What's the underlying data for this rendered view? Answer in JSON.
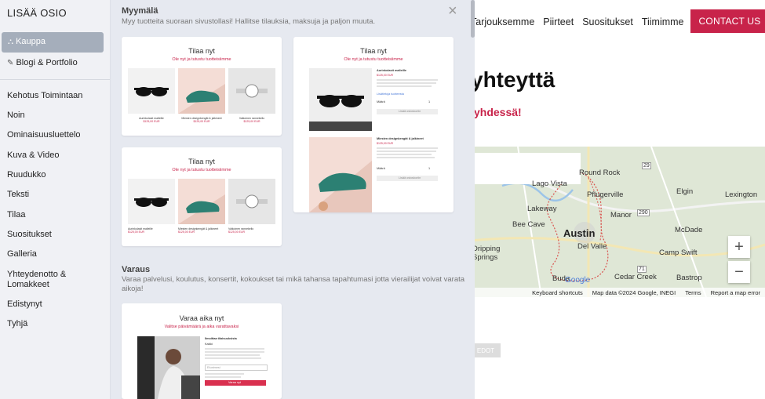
{
  "site": {
    "nav": [
      "Tarjouksemme",
      "Piirteet",
      "Suositukset",
      "Tiimimme"
    ],
    "contact_label": "CONTACT US",
    "heading": "yhteyttä",
    "subheading": "yhdessä!",
    "ghost_button": "EDOT",
    "map": {
      "labels": [
        "Round Rock",
        "Pflugerville",
        "Lago Vista",
        "Lakeway",
        "Manor",
        "Elgin",
        "Bee Cave",
        "McDade",
        "Austin",
        "Dripping Springs",
        "Del Valle",
        "Camp Swift",
        "Buda",
        "Cedar Creek",
        "Bastrop",
        "Lexington"
      ],
      "roads": [
        "29",
        "290",
        "71"
      ],
      "zoom_in": "+",
      "zoom_out": "−",
      "footer": [
        "Keyboard shortcuts",
        "Map data ©2024 Google, INEGI",
        "Terms",
        "Report a map error"
      ],
      "google": "Google"
    }
  },
  "sidebar": {
    "title": "LISÄÄ OSIO",
    "active": "Kauppa",
    "blog": "Blogi & Portfolio",
    "items": [
      "Kehotus Toimintaan",
      "Noin",
      "Ominaisuusluettelo",
      "Kuva & Video",
      "Ruudukko",
      "Teksti",
      "Tilaa",
      "Suositukset",
      "Galleria",
      "Yhteydenotto &",
      "Lomakkeet",
      "Edistynyt",
      "Tyhjä"
    ]
  },
  "panel": {
    "close": "×",
    "shop": {
      "title": "Myymälä",
      "desc": "Myy tuotteita suoraan sivustollasi! Hallitse tilauksia, maksuja ja paljon muuta."
    },
    "booking": {
      "title": "Varaus",
      "desc1": "Varaa palvelusi, koulutus, konsertit, kokoukset tai mikä tahansa tapahtumasi jotta vierailijat voivat varata",
      "desc2": "aikoja!"
    },
    "card_a": {
      "title": "Tilaa nyt",
      "sub": "Ole nyt ja tutustu tuotteisiimme",
      "products": [
        {
          "name": "Aurinkolasit malleille",
          "price": "$125,00 EUR"
        },
        {
          "name": "Miesten designkengät & jalkineet",
          "price": "$125,00 EUR"
        },
        {
          "name": "Valkoinen rannekello",
          "price": "$125,00 EUR"
        }
      ]
    },
    "card_b": {
      "title": "Tilaa nyt",
      "sub": "Ole nyt ja tutustu tuotteisiimme",
      "products": [
        {
          "name": "Aurinkolasit malleille",
          "price": "$125,00 EUR"
        },
        {
          "name": "Miesten designkengät & jalkineet",
          "price": "$125,00 EUR"
        },
        {
          "name": "Valkoinen rannekello",
          "price": "$125,00 EUR"
        }
      ]
    },
    "card_c": {
      "title": "Tilaa nyt",
      "sub": "Ole nyt ja tutustu tuotteisiimme",
      "p1": {
        "name": "Aurinkolasit malleille",
        "price": "$125,00 EUR",
        "link": "Lisätietoja tuotteesta"
      },
      "p2": {
        "name": "Miesten designkengät & jalkineet",
        "price": "$125,00 EUR"
      },
      "qty_label": "Määrä",
      "qty": "1",
      "add": "Lisää ostoskoriin"
    },
    "card_d": {
      "title": "Varaa aika nyt",
      "sub": "Valitse päivämäärä ja aika varattavaksi",
      "form_title": "Ilmoittaa tilaisuuksista",
      "option": "Kaikki",
      "field": "Etunimesi",
      "button": "Varaa nyt"
    }
  }
}
